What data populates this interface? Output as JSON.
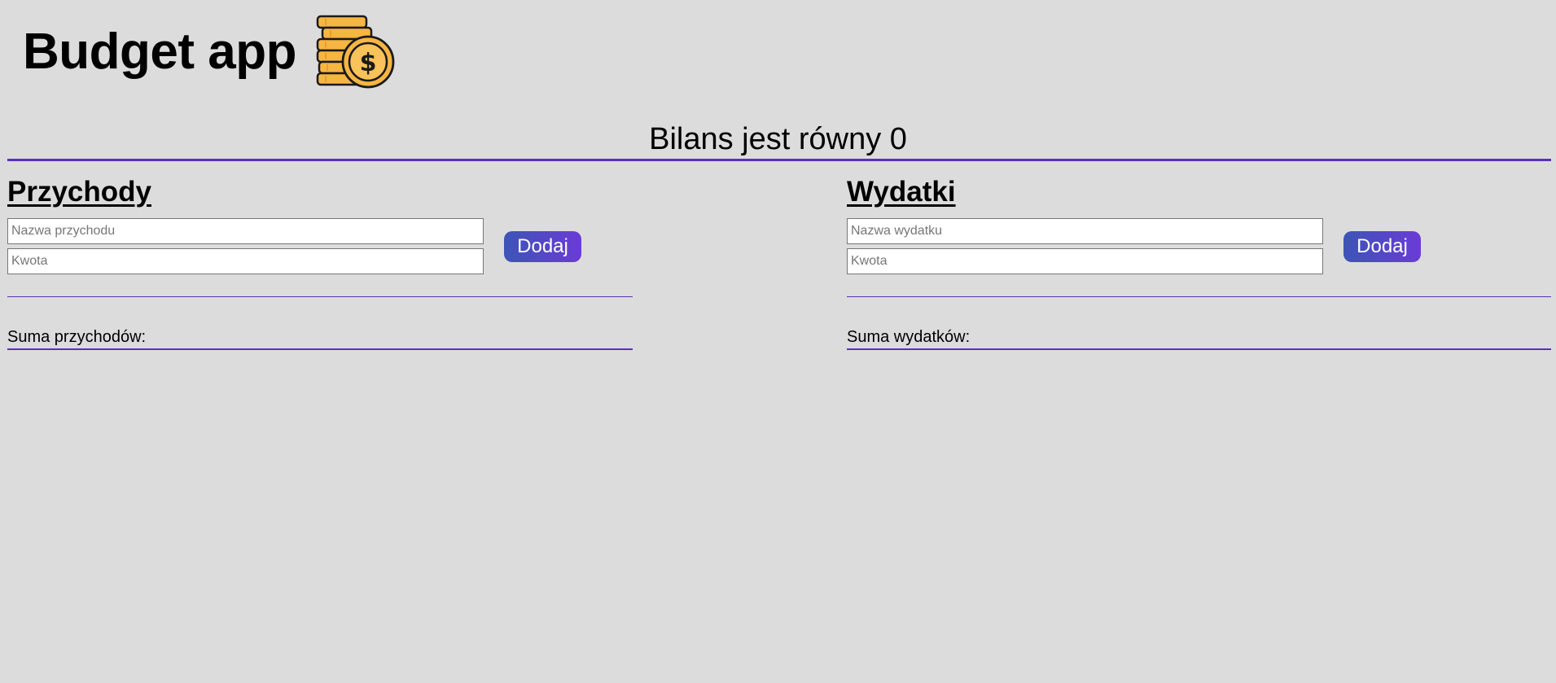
{
  "app": {
    "title": "Budget app",
    "logo_icon": "coins-stack-dollar-icon"
  },
  "balance": {
    "text": "Bilans jest równy 0"
  },
  "income": {
    "title": "Przychody",
    "name_placeholder": "Nazwa przychodu",
    "amount_placeholder": "Kwota",
    "add_label": "Dodaj",
    "sum_label": "Suma przychodów:"
  },
  "expenses": {
    "title": "Wydatki",
    "name_placeholder": "Nazwa wydatku",
    "amount_placeholder": "Kwota",
    "add_label": "Dodaj",
    "sum_label": "Suma wydatków:"
  },
  "colors": {
    "background": "#dcdcdc",
    "accent_line": "#5a32b4",
    "button_gradient_start": "#3d55b6",
    "button_gradient_end": "#6a3bd6",
    "coin_fill": "#f6b642"
  }
}
